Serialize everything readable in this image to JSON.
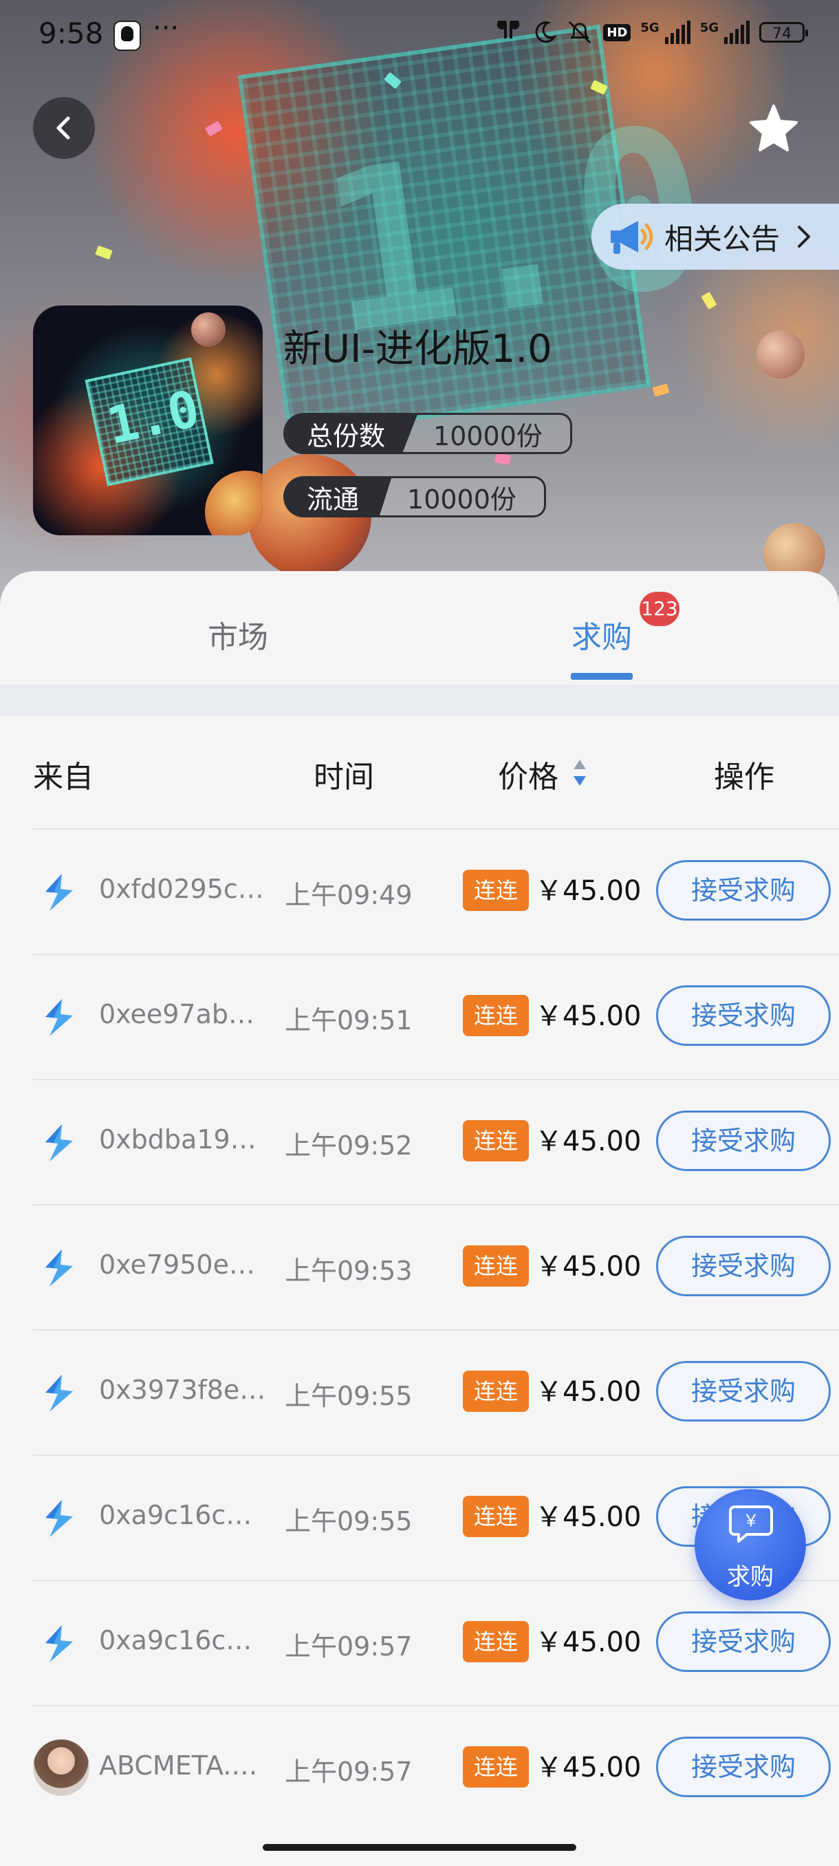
{
  "status_bar": {
    "time": "9:58",
    "dots": "···",
    "network_1": "5G",
    "network_2": "5G",
    "hd": "HD",
    "battery": "74"
  },
  "header": {
    "notice_label": "相关公告",
    "title": "新UI-进化版1.0",
    "hero_text": "1.0",
    "cover_text": "1.0",
    "meta": [
      {
        "key": "总份数",
        "value": "10000份"
      },
      {
        "key": "流通",
        "value": "10000份"
      }
    ]
  },
  "tabs": [
    {
      "label": "市场",
      "active": false
    },
    {
      "label": "求购",
      "active": true,
      "badge": "123"
    }
  ],
  "table": {
    "columns": [
      "来自",
      "时间",
      "价格",
      "操作"
    ],
    "pay_tag": "连连",
    "action_label": "接受求购",
    "rows": [
      {
        "from": "0xfd0295c…",
        "time": "上午09:49",
        "price": "￥45.00",
        "icon": "lightning-s-icon"
      },
      {
        "from": "0xee97ab…",
        "time": "上午09:51",
        "price": "￥45.00",
        "icon": "lightning-s-icon"
      },
      {
        "from": "0xbdba19…",
        "time": "上午09:52",
        "price": "￥45.00",
        "icon": "lightning-s-icon"
      },
      {
        "from": "0xe7950e…",
        "time": "上午09:53",
        "price": "￥45.00",
        "icon": "lightning-s-icon"
      },
      {
        "from": "0x3973f8e…",
        "time": "上午09:55",
        "price": "￥45.00",
        "icon": "lightning-s-icon"
      },
      {
        "from": "0xa9c16c…",
        "time": "上午09:55",
        "price": "￥45.00",
        "icon": "lightning-s-icon"
      },
      {
        "from": "0xa9c16c…",
        "time": "上午09:57",
        "price": "￥45.00",
        "icon": "lightning-s-icon"
      },
      {
        "from": "ABCMETA.…",
        "time": "上午09:57",
        "price": "￥45.00",
        "icon": "user-avatar"
      }
    ]
  },
  "fab": {
    "label": "求购",
    "icon_text": "￥"
  },
  "colors": {
    "accent_blue": "#3f84d8",
    "pay_orange": "#ef7b22",
    "badge_red": "#e04848"
  }
}
